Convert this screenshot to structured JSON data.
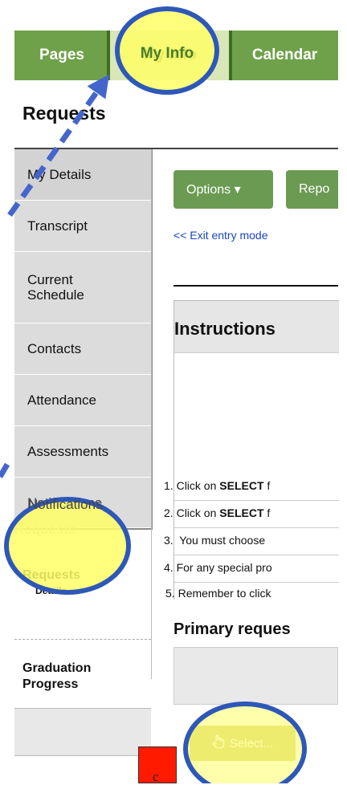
{
  "nav": {
    "tabs": [
      {
        "label": "Pages"
      },
      {
        "label": "My Info"
      },
      {
        "label": "Calendar"
      }
    ]
  },
  "page": {
    "title": "Requests"
  },
  "sidebar": {
    "items": [
      {
        "label": "My Details"
      },
      {
        "label": "Transcript"
      },
      {
        "label": "Current Schedule"
      },
      {
        "label": "Contacts"
      },
      {
        "label": "Attendance"
      },
      {
        "label": "Assessments"
      },
      {
        "label": "Notifications"
      }
    ],
    "ghost_label": "Requests",
    "requests": {
      "label": "Requests",
      "sublabel": "Details"
    },
    "graduation": {
      "label": "Graduation Progress"
    }
  },
  "toolbar": {
    "options_label": "Options ▾",
    "reports_label": "Repo"
  },
  "exit_link": "<< Exit entry mode",
  "instructions": {
    "title": "Instructions",
    "items": [
      {
        "num": "1.",
        "prefix": "Click on ",
        "bold": "SELECT",
        "suffix": " f"
      },
      {
        "num": "2.",
        "prefix": "Click on ",
        "bold": "SELECT",
        "suffix": " f"
      },
      {
        "num": "3.",
        "prefix": " You must choose",
        "bold": "",
        "suffix": ""
      },
      {
        "num": "4.",
        "prefix": "For any special pro",
        "bold": "",
        "suffix": ""
      },
      {
        "num": "5.",
        "prefix": "Remember to click",
        "bold": "",
        "suffix": ""
      }
    ]
  },
  "primary": {
    "title": "Primary reques",
    "select_label": "Select..."
  },
  "annotation": {
    "letter": "c"
  },
  "colors": {
    "nav_green": "#6fa14a",
    "button_green": "#6b9a53",
    "highlight_yellow": "#ffff66",
    "ring_blue": "#2e58b8",
    "marker_red": "#ff1a00"
  }
}
